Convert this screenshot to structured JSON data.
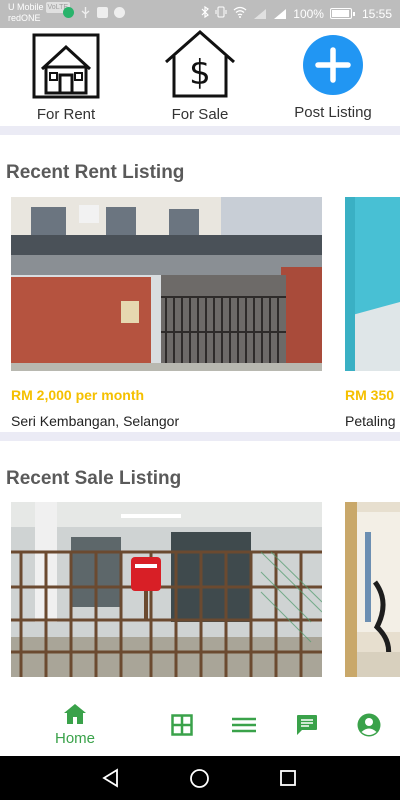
{
  "status_bar": {
    "carrier_line1": "U Mobile",
    "carrier_badge": "VoLTE",
    "carrier_line2": "redONE",
    "battery_percent": "100%",
    "battery_level": 1.0,
    "time": "15:55"
  },
  "actions": {
    "for_rent": "For Rent",
    "for_sale": "For Sale",
    "post_listing": "Post Listing"
  },
  "rent_section": {
    "title": "Recent Rent Listing",
    "listings": [
      {
        "price": "RM 2,000 per month",
        "location": "Seri Kembangan, Selangor"
      },
      {
        "price": "RM 350",
        "location": "Petaling"
      }
    ]
  },
  "sale_section": {
    "title": "Recent Sale Listing"
  },
  "bottom_nav": {
    "home_label": "Home",
    "items": [
      "home-icon",
      "grid-icon",
      "menu-icon",
      "chat-icon",
      "account-icon"
    ]
  },
  "colors": {
    "accent_green": "#3aa24a",
    "price_yellow": "#f5c000",
    "post_blue": "#2196f3",
    "band": "#ebebf5"
  }
}
